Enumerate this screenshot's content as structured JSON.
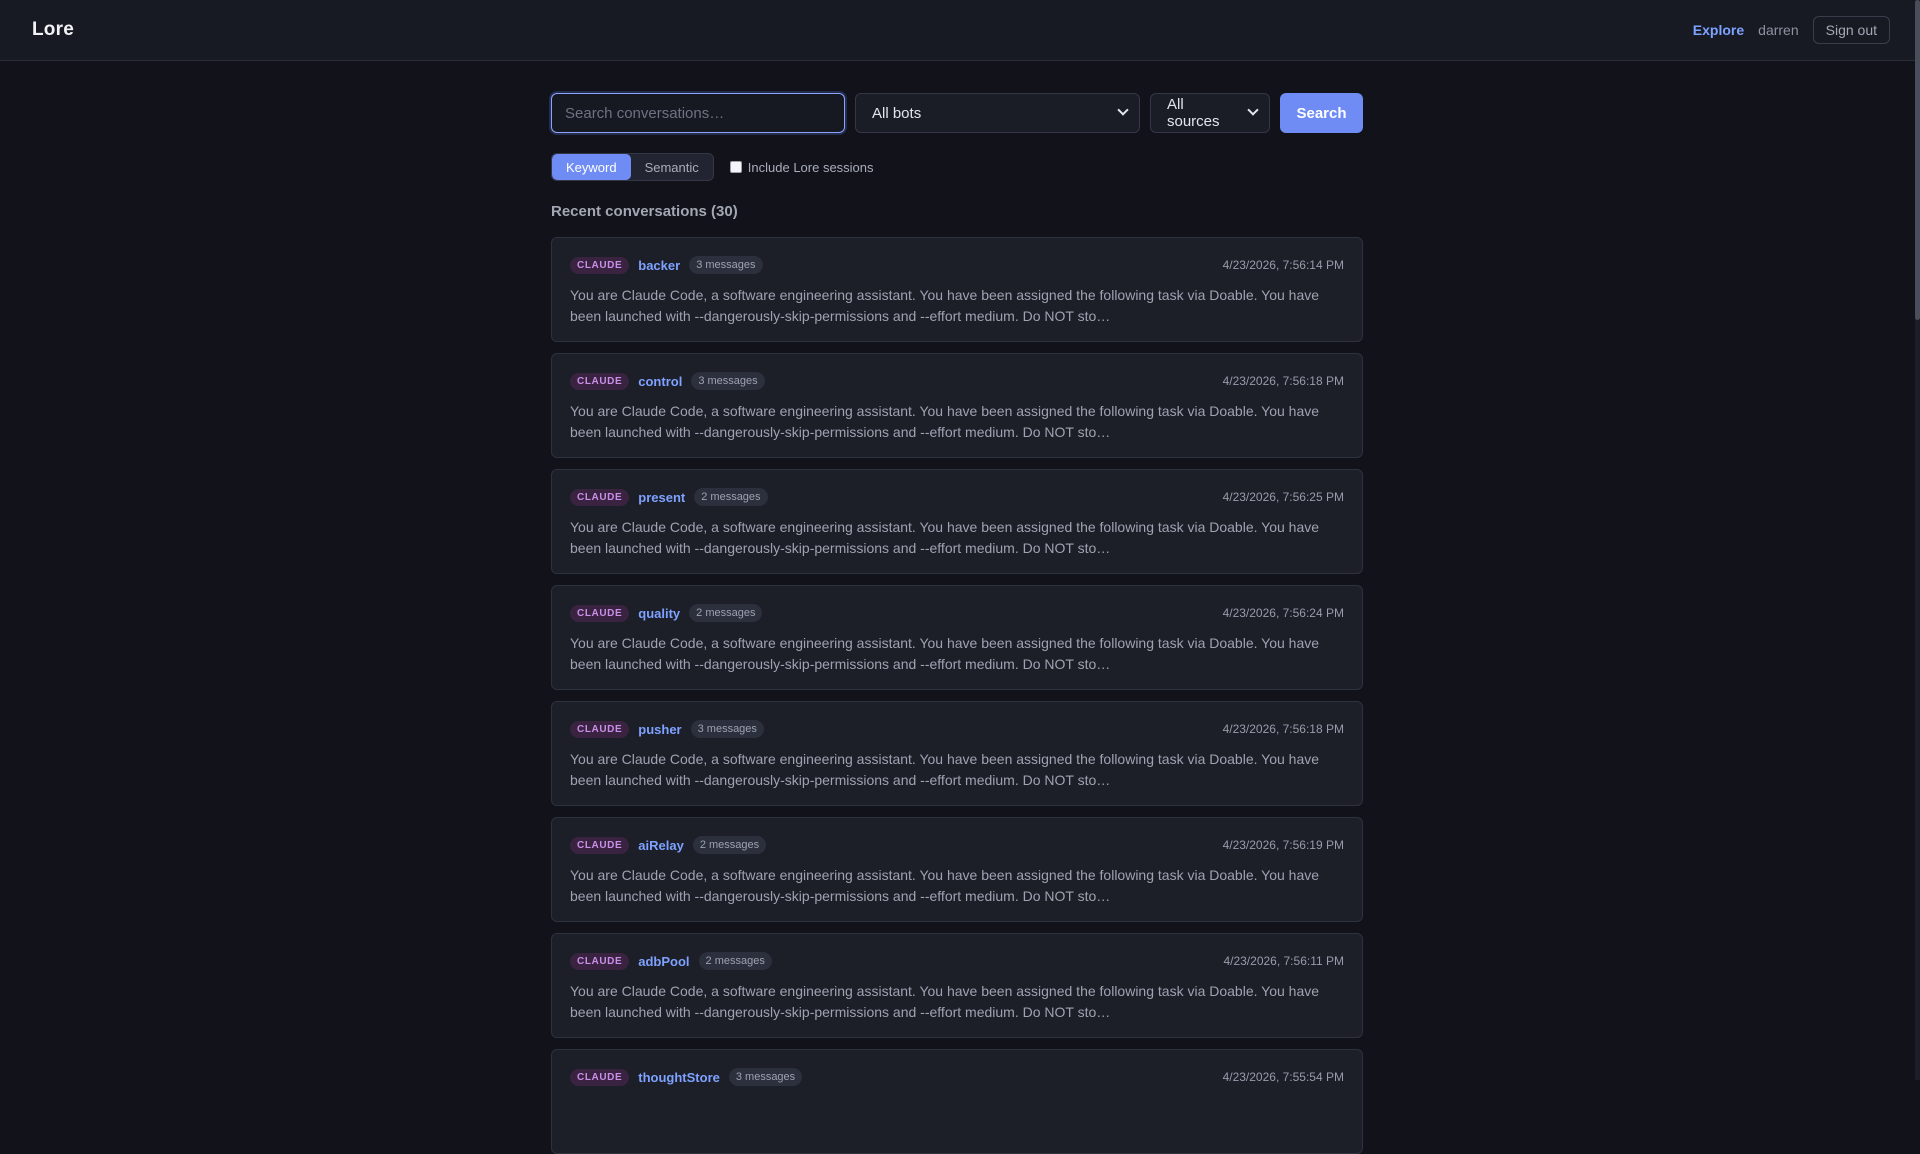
{
  "header": {
    "logo_icon": "book-icon",
    "logo_glyph": "",
    "app_name": "Lore",
    "nav_explore": "Explore",
    "username": "darren",
    "sign_out": "Sign out"
  },
  "search": {
    "placeholder": "Search conversations…",
    "value": "",
    "bots_selected": "All bots",
    "sources_selected": "All sources",
    "button_label": "Search"
  },
  "modes": {
    "keyword": "Keyword",
    "semantic": "Semantic",
    "active": "Keyword",
    "include_label": "Include Lore sessions",
    "include_checked": false
  },
  "list": {
    "title": "Recent conversations (30)"
  },
  "conversations": [
    {
      "tag": "CLAUDE",
      "bot": "backer",
      "count": "3 messages",
      "time": "4/23/2026, 7:56:14 PM",
      "preview": "You are Claude Code, a software engineering assistant. You have been assigned the following task via Doable. You have been launched with --dangerously-skip-permissions and --effort medium. Do NOT sto…"
    },
    {
      "tag": "CLAUDE",
      "bot": "control",
      "count": "3 messages",
      "time": "4/23/2026, 7:56:18 PM",
      "preview": "You are Claude Code, a software engineering assistant. You have been assigned the following task via Doable. You have been launched with --dangerously-skip-permissions and --effort medium. Do NOT sto…"
    },
    {
      "tag": "CLAUDE",
      "bot": "present",
      "count": "2 messages",
      "time": "4/23/2026, 7:56:25 PM",
      "preview": "You are Claude Code, a software engineering assistant. You have been assigned the following task via Doable. You have been launched with --dangerously-skip-permissions and --effort medium. Do NOT sto…"
    },
    {
      "tag": "CLAUDE",
      "bot": "quality",
      "count": "2 messages",
      "time": "4/23/2026, 7:56:24 PM",
      "preview": "You are Claude Code, a software engineering assistant. You have been assigned the following task via Doable. You have been launched with --dangerously-skip-permissions and --effort medium. Do NOT sto…"
    },
    {
      "tag": "CLAUDE",
      "bot": "pusher",
      "count": "3 messages",
      "time": "4/23/2026, 7:56:18 PM",
      "preview": "You are Claude Code, a software engineering assistant. You have been assigned the following task via Doable. You have been launched with --dangerously-skip-permissions and --effort medium. Do NOT sto…"
    },
    {
      "tag": "CLAUDE",
      "bot": "aiRelay",
      "count": "2 messages",
      "time": "4/23/2026, 7:56:19 PM",
      "preview": "You are Claude Code, a software engineering assistant. You have been assigned the following task via Doable. You have been launched with --dangerously-skip-permissions and --effort medium. Do NOT sto…"
    },
    {
      "tag": "CLAUDE",
      "bot": "adbPool",
      "count": "2 messages",
      "time": "4/23/2026, 7:56:11 PM",
      "preview": "You are Claude Code, a software engineering assistant. You have been assigned the following task via Doable. You have been launched with --dangerously-skip-permissions and --effort medium. Do NOT sto…"
    },
    {
      "tag": "CLAUDE",
      "bot": "thoughtStore",
      "count": "3 messages",
      "time": "4/23/2026, 7:55:54 PM",
      "preview": ""
    }
  ],
  "colors": {
    "accent": "#6f8cf5",
    "link": "#7ea2ff",
    "tag_text": "#c98ee8",
    "background": "#11121a"
  }
}
